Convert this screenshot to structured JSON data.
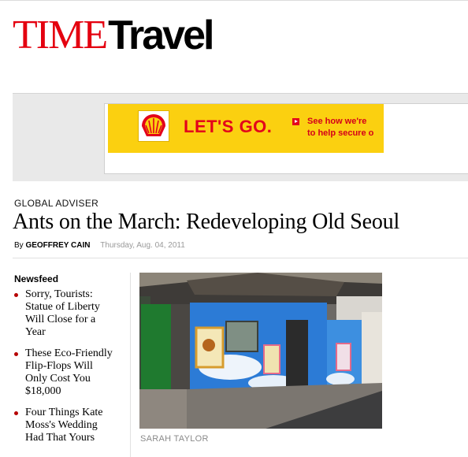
{
  "masthead": {
    "time": "TIME",
    "travel": "Travel"
  },
  "ad": {
    "headline": "LET'S GO.",
    "small_line1": "See how we're",
    "small_line2": "to help secure o",
    "brand_icon": "shell-logo-icon",
    "colors": {
      "background": "#fbd010",
      "red": "#e3001b"
    }
  },
  "article": {
    "section": "GLOBAL ADVISER",
    "headline": "Ants on the March: Redeveloping Old Seoul",
    "byline_prefix": "By",
    "author": "GEOFFREY CAIN",
    "date": "Thursday, Aug. 04, 2011",
    "photo_credit": "SARAH TAYLOR"
  },
  "newsfeed": {
    "title": "Newsfeed",
    "items": [
      {
        "label": "Sorry, Tourists: Statue of Liberty Will Close for a Year"
      },
      {
        "label": "These Eco-Friendly Flip-Flops Will Only Cost You $18,000"
      },
      {
        "label": "Four Things Kate Moss's Wedding Had That Yours"
      }
    ]
  },
  "colors": {
    "time_red": "#e4000f",
    "bullet_red": "#b60000"
  }
}
